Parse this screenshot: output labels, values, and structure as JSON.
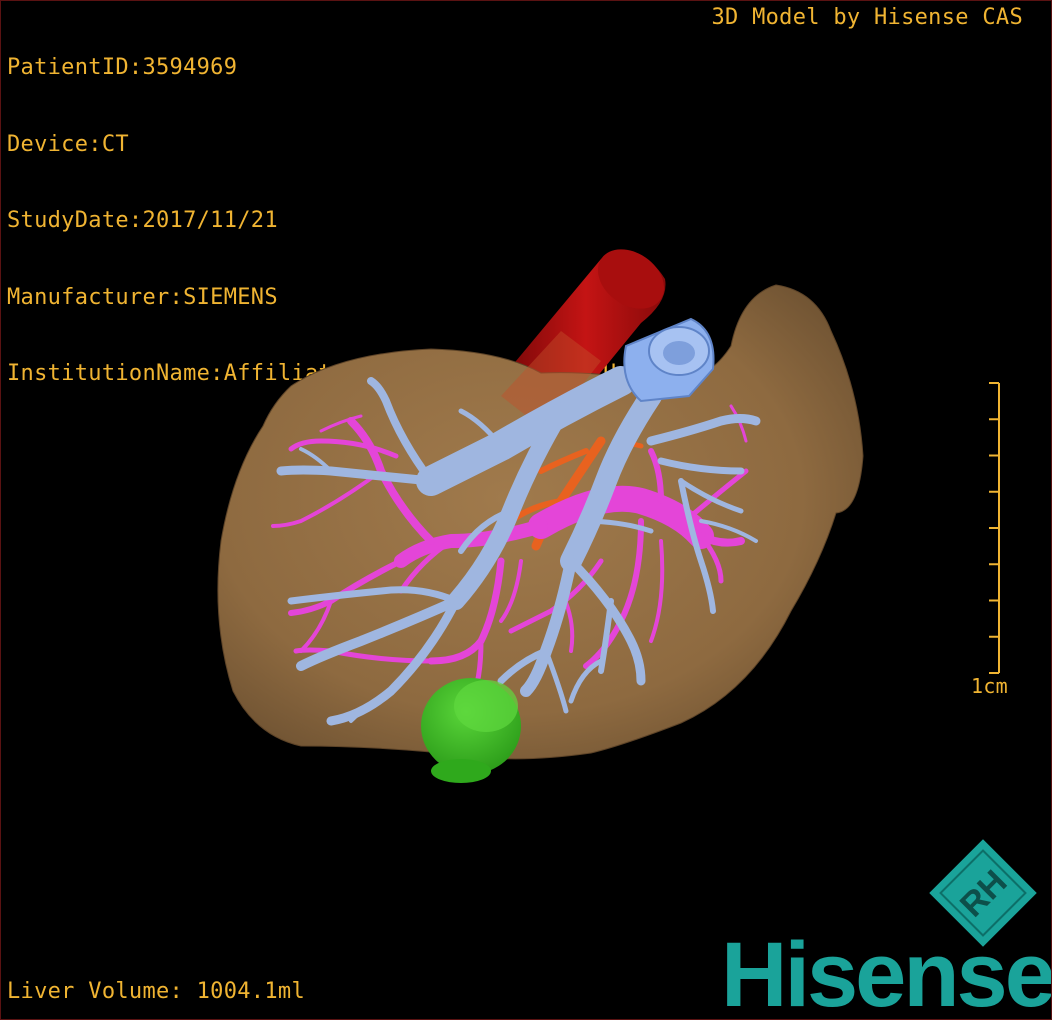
{
  "overlay": {
    "patient_line": "PatientID:3594969",
    "device_line": "Device:CT",
    "study_date_line": "StudyDate:2017/11/21",
    "manufacturer_line": "Manufacturer:SIEMENS",
    "institution_line": "InstitutionName:Affiliated Hospital Qingdao University-C",
    "credit": "3D Model by Hisense CAS",
    "liver_volume": "Liver Volume: 1004.1ml"
  },
  "scale_bar": {
    "label": "1cm",
    "tick_count": 9
  },
  "logo": {
    "badge_text": "RH",
    "brand_text": "Hisense"
  },
  "colors": {
    "overlay_text": "#f0b432",
    "liver_surface": "#9b7447",
    "aorta": "#b01010",
    "portal_vein": "#e445d8",
    "hepatic_vein": "#9fb6e0",
    "ivc": "#8db0ee",
    "artery": "#e8621f",
    "lesion": "#3cc021",
    "brand": "#1aa39a"
  }
}
